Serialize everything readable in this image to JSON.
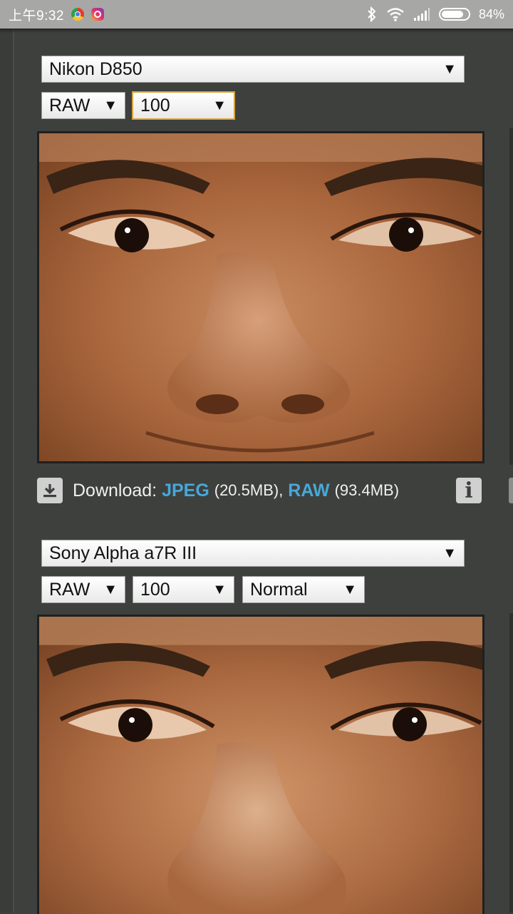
{
  "status_bar": {
    "time": "上午9:32",
    "battery_percent": "84%",
    "battery_level": 0.84,
    "icons": [
      "chrome-icon",
      "instagram-icon",
      "bluetooth-icon",
      "wifi-icon",
      "signal-icon",
      "battery-icon"
    ]
  },
  "comparison_1": {
    "camera": "Nikon D850",
    "format": "RAW",
    "iso": "100",
    "download": {
      "label": "Download:",
      "jpeg_label": "JPEG",
      "jpeg_size": "(20.5MB),",
      "raw_label": "RAW",
      "raw_size": "(93.4MB)"
    }
  },
  "comparison_2": {
    "camera": "Sony Alpha a7R III",
    "format": "RAW",
    "iso": "100",
    "mode": "Normal"
  },
  "colors": {
    "accent_link": "#48a8d8",
    "focus_border": "#d9a33b",
    "page_bg": "#3e403e"
  }
}
